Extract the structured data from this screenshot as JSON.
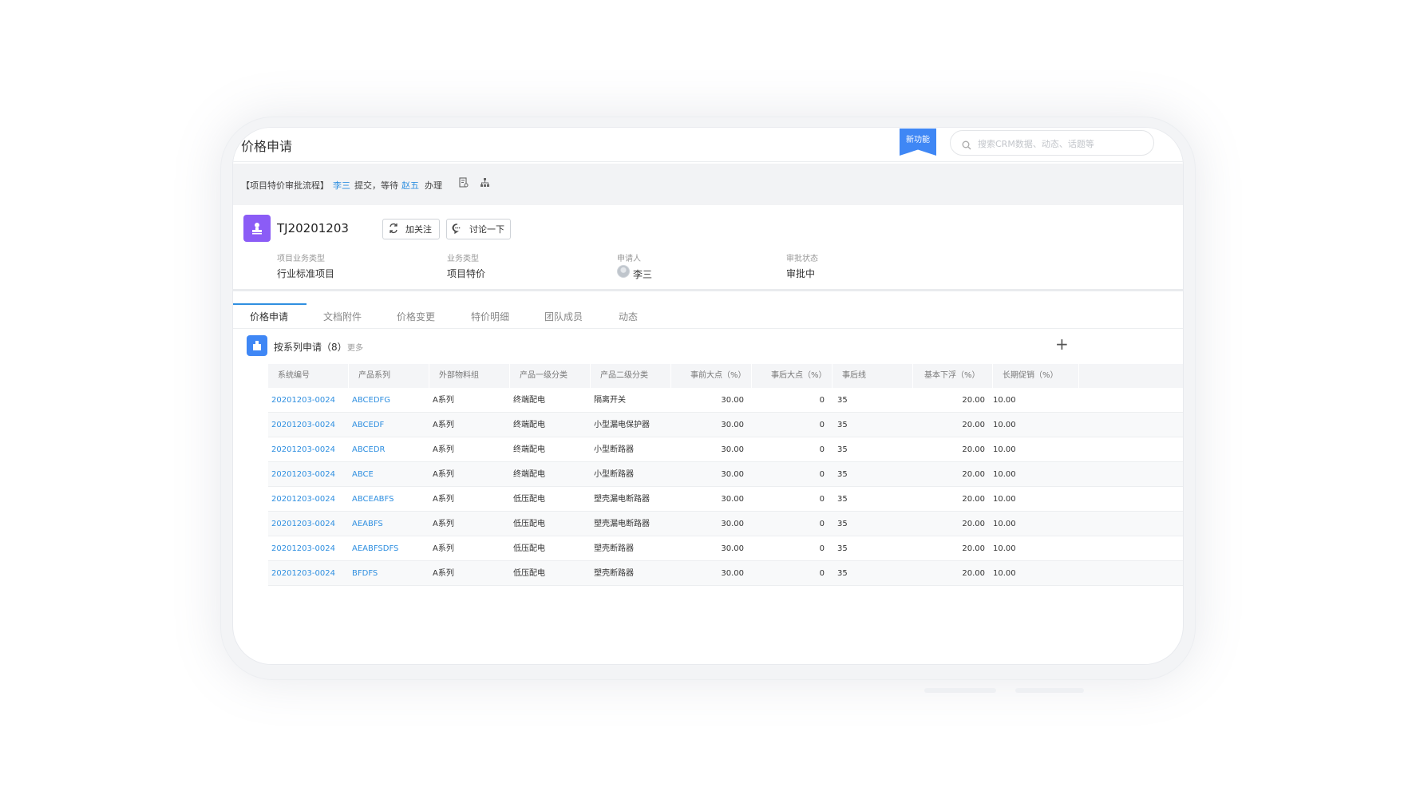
{
  "topbar": {
    "title": "价格申请",
    "new_feature_badge": "新功能",
    "search_placeholder": "搜索CRM数据、动态、话题等"
  },
  "workflow": {
    "process_name": "【项目特价审批流程】",
    "submitter": "李三",
    "submitted_text": "提交，等待",
    "handler": "赵五",
    "handle_text": "办理"
  },
  "record": {
    "number": "TJ20201203",
    "follow_label": "加关注",
    "discuss_label": "讨论一下",
    "fields": [
      {
        "label": "项目业务类型",
        "value": "行业标准项目"
      },
      {
        "label": "业务类型",
        "value": "项目特价"
      },
      {
        "label": "申请人",
        "value": "李三"
      },
      {
        "label": "审批状态",
        "value": "审批中"
      }
    ]
  },
  "tabs": [
    "价格申请",
    "文档附件",
    "价格变更",
    "特价明细",
    "团队成员",
    "动态"
  ],
  "section": {
    "title": "按系列申请（8）",
    "more": "更多"
  },
  "table": {
    "columns": [
      "系统编号",
      "产品系列",
      "外部物料组",
      "产品一级分类",
      "产品二级分类",
      "事前大点（%）",
      "事后大点（%）",
      "事后线",
      "基本下浮（%）",
      "长期促销（%）"
    ],
    "rows": [
      [
        "20201203-0024",
        "ABCEDFG",
        "A系列",
        "终端配电",
        "隔离开关",
        "30.00",
        "0",
        "35",
        "20.00",
        "10.00"
      ],
      [
        "20201203-0024",
        "ABCEDF",
        "A系列",
        "终端配电",
        "小型漏电保护器",
        "30.00",
        "0",
        "35",
        "20.00",
        "10.00"
      ],
      [
        "20201203-0024",
        "ABCEDR",
        "A系列",
        "终端配电",
        "小型断路器",
        "30.00",
        "0",
        "35",
        "20.00",
        "10.00"
      ],
      [
        "20201203-0024",
        "ABCE",
        "A系列",
        "终端配电",
        "小型断路器",
        "30.00",
        "0",
        "35",
        "20.00",
        "10.00"
      ],
      [
        "20201203-0024",
        "ABCEABFS",
        "A系列",
        "低压配电",
        "塑壳漏电断路器",
        "30.00",
        "0",
        "35",
        "20.00",
        "10.00"
      ],
      [
        "20201203-0024",
        "AEABFS",
        "A系列",
        "低压配电",
        "塑壳漏电断路器",
        "30.00",
        "0",
        "35",
        "20.00",
        "10.00"
      ],
      [
        "20201203-0024",
        "AEABFSDFS",
        "A系列",
        "低压配电",
        "塑壳断路器",
        "30.00",
        "0",
        "35",
        "20.00",
        "10.00"
      ],
      [
        "20201203-0024",
        "BFDFS",
        "A系列",
        "低压配电",
        "塑壳断路器",
        "30.00",
        "0",
        "35",
        "20.00",
        "10.00"
      ]
    ]
  },
  "colors": {
    "accent": "#2f8fe0",
    "badge": "#3f87f5",
    "avatar": "#8b5cf6"
  }
}
